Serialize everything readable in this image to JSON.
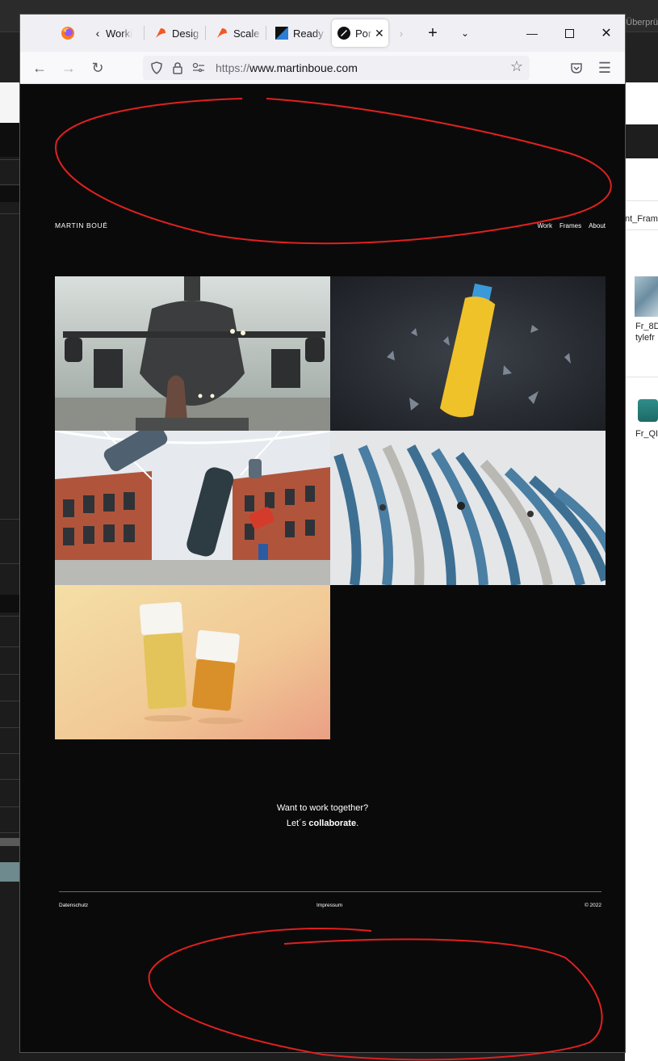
{
  "background": {
    "right_top_text": "Überprü",
    "right_app": {
      "label_1": "nt_Fram",
      "file_1_line1": "Fr_8D",
      "file_1_line2": "tylefr",
      "file_2": "Fr_QI"
    }
  },
  "browser": {
    "tabs": [
      {
        "title": "Worki"
      },
      {
        "title": "Desig"
      },
      {
        "title": "Scale"
      },
      {
        "title": "Ready"
      },
      {
        "title": "Por"
      }
    ],
    "url_scheme": "https://",
    "url_host": "www.martinboue.com"
  },
  "site": {
    "logo": "MARTIN BOUÉ",
    "nav": [
      "Work",
      "Frames",
      "About"
    ],
    "cta_line1": "Want to work together?",
    "cta_line2_prefix": "Let´s ",
    "cta_line2_bold": "collaborate",
    "cta_line2_suffix": ".",
    "footer": {
      "left": "Datenschutz",
      "center": "Impressum",
      "right": "© 2022"
    }
  },
  "colors": {
    "page_bg": "#0a0a0a",
    "tabbar_bg": "#f0f0f4",
    "annotation": "#e02020",
    "firefox_orange": "#e8540f",
    "figma_orange": "#f05a24"
  }
}
